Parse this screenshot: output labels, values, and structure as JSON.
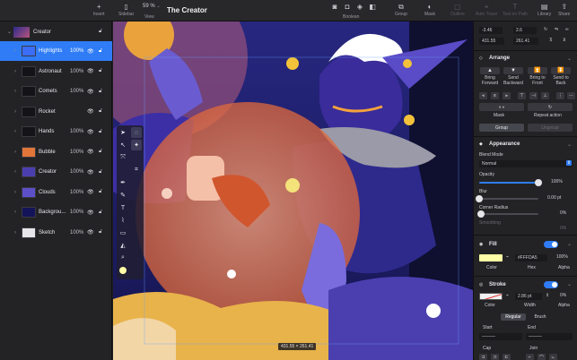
{
  "toolbar": {
    "insert_label": "Insert",
    "sidebar_label": "Sidebar",
    "zoom_value": "59 %",
    "view_label": "View",
    "doc_title": "The Creator",
    "boolean_label": "Boolean",
    "group_label": "Group",
    "mask_label": "Mask",
    "outline_label": "Outline",
    "auto_trace_label": "Auto Trace",
    "text_to_path_label": "Text on Path",
    "library_label": "Library",
    "share_label": "Share"
  },
  "layers": {
    "group_name": "Creator",
    "items": [
      {
        "name": "Highlights",
        "opacity": "100%",
        "selected": true,
        "thumb": "#3b6df6"
      },
      {
        "name": "Astronaut",
        "opacity": "100%",
        "selected": false,
        "thumb": "#141418"
      },
      {
        "name": "Comets",
        "opacity": "100%",
        "selected": false,
        "thumb": "#141418"
      },
      {
        "name": "Rocket",
        "opacity": "",
        "selected": false,
        "thumb": "#141418"
      },
      {
        "name": "Hands",
        "opacity": "100%",
        "selected": false,
        "thumb": "#141418"
      },
      {
        "name": "Bubble",
        "opacity": "100%",
        "selected": false,
        "thumb": "#e0763a"
      },
      {
        "name": "Creator",
        "opacity": "100%",
        "selected": false,
        "thumb": "#4b3fb0"
      },
      {
        "name": "Clouds",
        "opacity": "100%",
        "selected": false,
        "thumb": "#5c4fc8"
      },
      {
        "name": "Backgrou...",
        "opacity": "100%",
        "selected": false,
        "thumb": "#14145a"
      },
      {
        "name": "Sketch",
        "opacity": "100%",
        "selected": false,
        "thumb": "#e6e6ea"
      }
    ]
  },
  "canvas": {
    "coord_readout": "431.55 × 261.41"
  },
  "inspector": {
    "x_value": "-3.46",
    "y_value": "2.6",
    "w_value": "431.55",
    "h_value": "261.41",
    "arrange": {
      "title": "Arrange",
      "bring_forward": "Bring Forward",
      "send_backward": "Send Backward",
      "bring_to_front": "Bring to Front",
      "send_to_back": "Send to Back",
      "mask": "Mask",
      "repeat_action": "Repeat action",
      "group": "Group",
      "ungroup": "Ungroup"
    },
    "appearance": {
      "title": "Appearance",
      "blend_mode_label": "Blend Mode",
      "blend_mode_value": "Normal",
      "opacity_label": "Opacity",
      "opacity_value": "100%",
      "opacity_level": 1.0,
      "blur_label": "Blur",
      "blur_value": "0.00 pt",
      "blur_level": 0.0,
      "corner_radius_label": "Corner Radius",
      "corner_radius_value": "0%",
      "smoothing_label": "Smoothing",
      "smoothing_value": "0%"
    },
    "fill": {
      "title": "Fill",
      "color_label": "Color",
      "hex_label": "Hex",
      "alpha_label": "Alpha",
      "hex_value": "#FFFDA5",
      "alpha_value": "100%",
      "color": "#FFFDA5"
    },
    "stroke": {
      "title": "Stroke",
      "color_label": "Color",
      "width_label": "Width",
      "alpha_label": "Alpha",
      "width_value": "2.86 pt",
      "alpha_value": "0%",
      "tab_regular": "Regular",
      "tab_brush": "Brush",
      "start_label": "Start",
      "end_label": "End",
      "cap_label": "Cap",
      "join_label": "Join"
    }
  },
  "colors": {
    "accent": "#2f7cf6",
    "panel": "#232326",
    "canvas_bg": "#20205c"
  }
}
